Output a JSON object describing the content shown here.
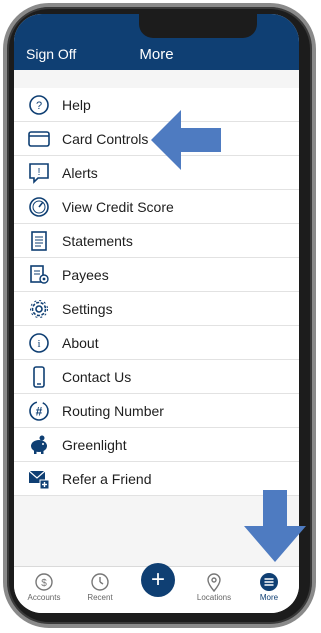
{
  "header": {
    "sign_off": "Sign Off",
    "title": "More"
  },
  "menu": {
    "items": [
      {
        "label": "Help",
        "icon": "help-icon"
      },
      {
        "label": "Card Controls",
        "icon": "card-icon"
      },
      {
        "label": "Alerts",
        "icon": "alert-icon"
      },
      {
        "label": "View Credit Score",
        "icon": "gauge-icon"
      },
      {
        "label": "Statements",
        "icon": "document-icon"
      },
      {
        "label": "Payees",
        "icon": "payees-icon"
      },
      {
        "label": "Settings",
        "icon": "gear-icon"
      },
      {
        "label": "About",
        "icon": "info-icon"
      },
      {
        "label": "Contact Us",
        "icon": "phone-icon"
      },
      {
        "label": "Routing Number",
        "icon": "hash-icon"
      },
      {
        "label": "Greenlight",
        "icon": "piggy-bank-icon"
      },
      {
        "label": "Refer a Friend",
        "icon": "refer-icon"
      }
    ]
  },
  "bottom_nav": {
    "accounts": "Accounts",
    "recent": "Recent",
    "locations": "Locations",
    "more": "More"
  },
  "colors": {
    "brand": "#0f3f73",
    "arrow": "#4e7bc1"
  }
}
